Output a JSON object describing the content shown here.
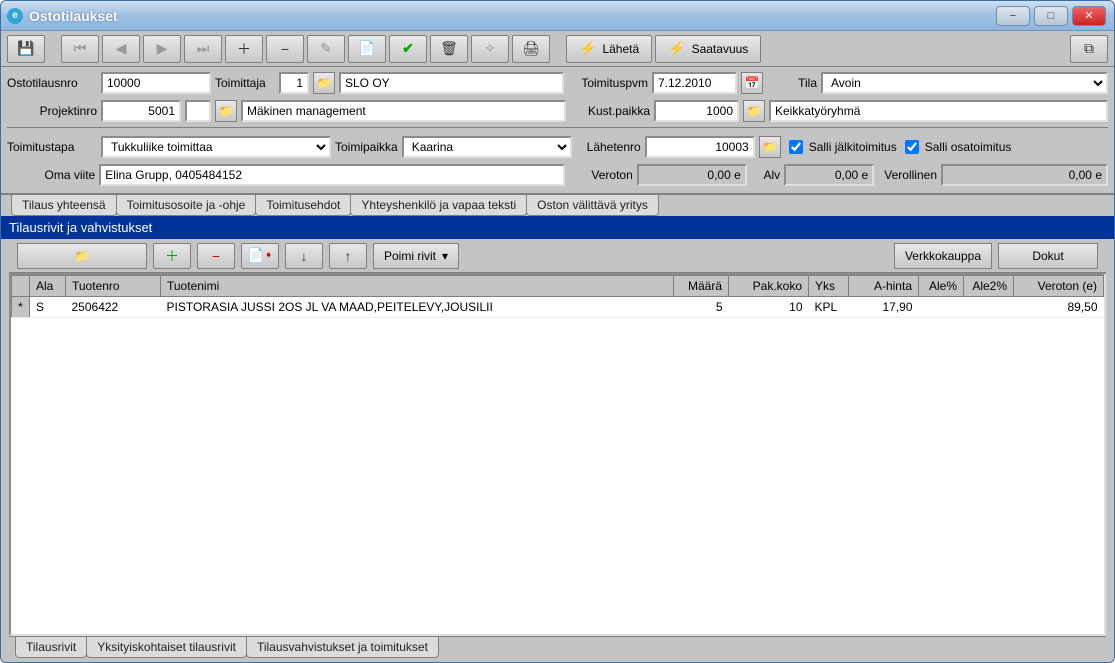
{
  "window": {
    "title": "Ostotilaukset",
    "icon_letter": "e"
  },
  "toolbar": {
    "laheta": "Lähetä",
    "saatavuus": "Saatavuus"
  },
  "form": {
    "ostotilausnro_lbl": "Ostotilausnro",
    "ostotilausnro": "10000",
    "toimittaja_lbl": "Toimittaja",
    "toimittaja_num": "1",
    "toimittaja_name": "SLO OY",
    "toimituspvm_lbl": "Toimituspvm",
    "toimituspvm": "7.12.2010",
    "tila_lbl": "Tila",
    "tila": "Avoin",
    "projektinro_lbl": "Projektinro",
    "projektinro": "5001",
    "projekti_name": "Mäkinen management",
    "kustpaikka_lbl": "Kust.paikka",
    "kustpaikka": "1000",
    "kustpaikka_name": "Keikkatyöryhmä",
    "toimitustapa_lbl": "Toimitustapa",
    "toimitustapa": "Tukkuliike toimittaa",
    "toimipaikka_lbl": "Toimipaikka",
    "toimipaikka": "Kaarina",
    "lahetenro_lbl": "Lähetenro",
    "lahetenro": "10003",
    "salli_jalki_lbl": "Salli jälkitoimitus",
    "salli_osa_lbl": "Salli osatoimitus",
    "oma_viite_lbl": "Oma viite",
    "oma_viite": "Elina Grupp, 0405484152",
    "veroton_lbl": "Veroton",
    "veroton": "0,00 e",
    "alv_lbl": "Alv",
    "alv": "0,00 e",
    "verollinen_lbl": "Verollinen",
    "verollinen": "0,00 e"
  },
  "tabs_upper": [
    "Tilaus yhteensä",
    "Toimitusosoite ja -ohje",
    "Toimitusehdot",
    "Yhteyshenkilö ja vapaa teksti",
    "Oston välittävä yritys"
  ],
  "section_title": "Tilausrivit ja vahvistukset",
  "grid_toolbar": {
    "poimi": "Poimi rivit",
    "verkkokauppa": "Verkkokauppa",
    "dokut": "Dokut"
  },
  "grid": {
    "headers": {
      "marker": "*",
      "ala": "Ala",
      "tuotenro": "Tuotenro",
      "tuotenimi": "Tuotenimi",
      "maara": "Määrä",
      "pakkoko": "Pak.koko",
      "yks": "Yks",
      "ahinta": "A-hinta",
      "ale": "Ale%",
      "ale2": "Ale2%",
      "veroton": "Veroton (e)"
    },
    "rows": [
      {
        "ala": "S",
        "tuotenro": "2506422",
        "tuotenimi": "PISTORASIA JUSSI 2OS JL VA MAAD,PEITELEVY,JOUSILII",
        "maara": "5",
        "pakkoko": "10",
        "yks": "KPL",
        "ahinta": "17,90",
        "ale": "",
        "ale2": "",
        "veroton": "89,50"
      }
    ]
  },
  "tabs_lower": [
    "Tilausrivit",
    "Yksityiskohtaiset tilausrivit",
    "Tilausvahvistukset ja toimitukset"
  ]
}
